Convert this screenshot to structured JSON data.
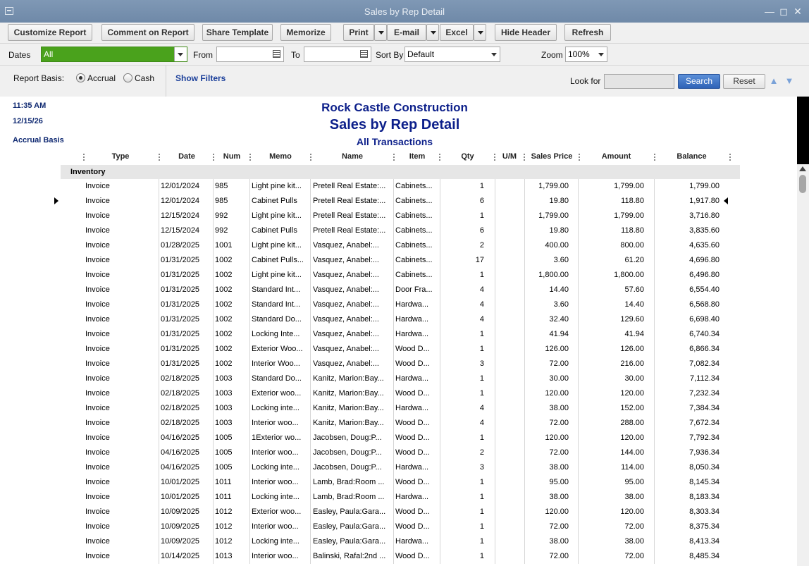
{
  "window": {
    "title": "Sales by Rep Detail"
  },
  "toolbar": {
    "customize": "Customize Report",
    "comment": "Comment on Report",
    "share": "Share Template",
    "memorize": "Memorize",
    "print": "Print",
    "email": "E-mail",
    "excel": "Excel",
    "hide_header": "Hide Header",
    "refresh": "Refresh"
  },
  "filters": {
    "dates_label": "Dates",
    "dates_value": "All",
    "from_label": "From",
    "from_value": "",
    "to_label": "To",
    "to_value": "",
    "sortby_label": "Sort By",
    "sortby_value": "Default",
    "zoom_label": "Zoom",
    "zoom_value": "100%"
  },
  "basis": {
    "label": "Report Basis:",
    "accrual": "Accrual",
    "cash": "Cash",
    "selected": "Accrual",
    "show_filters": "Show Filters",
    "lookfor_label": "Look for",
    "lookfor_value": "",
    "search": "Search",
    "reset": "Reset"
  },
  "report": {
    "time": "11:35 AM",
    "date": "12/15/26",
    "basis": "Accrual Basis",
    "company": "Rock Castle Construction",
    "title": "Sales by Rep Detail",
    "subtitle": "All Transactions",
    "columns": [
      "Type",
      "Date",
      "Num",
      "Memo",
      "Name",
      "Item",
      "Qty",
      "U/M",
      "Sales Price",
      "Amount",
      "Balance"
    ],
    "section": "Inventory",
    "rows": [
      [
        "Invoice",
        "12/01/2024",
        "985",
        "Light pine kit...",
        "Pretell Real Estate:...",
        "Cabinets...",
        "1",
        "",
        "1,799.00",
        "1,799.00",
        "1,799.00"
      ],
      [
        "Invoice",
        "12/01/2024",
        "985",
        "Cabinet Pulls",
        "Pretell Real Estate:...",
        "Cabinets...",
        "6",
        "",
        "19.80",
        "118.80",
        "1,917.80"
      ],
      [
        "Invoice",
        "12/15/2024",
        "992",
        "Light pine kit...",
        "Pretell Real Estate:...",
        "Cabinets...",
        "1",
        "",
        "1,799.00",
        "1,799.00",
        "3,716.80"
      ],
      [
        "Invoice",
        "12/15/2024",
        "992",
        "Cabinet Pulls",
        "Pretell Real Estate:...",
        "Cabinets...",
        "6",
        "",
        "19.80",
        "118.80",
        "3,835.60"
      ],
      [
        "Invoice",
        "01/28/2025",
        "1001",
        "Light pine kit...",
        "Vasquez, Anabel:...",
        "Cabinets...",
        "2",
        "",
        "400.00",
        "800.00",
        "4,635.60"
      ],
      [
        "Invoice",
        "01/31/2025",
        "1002",
        "Cabinet Pulls...",
        "Vasquez, Anabel:...",
        "Cabinets...",
        "17",
        "",
        "3.60",
        "61.20",
        "4,696.80"
      ],
      [
        "Invoice",
        "01/31/2025",
        "1002",
        "Light pine kit...",
        "Vasquez, Anabel:...",
        "Cabinets...",
        "1",
        "",
        "1,800.00",
        "1,800.00",
        "6,496.80"
      ],
      [
        "Invoice",
        "01/31/2025",
        "1002",
        "Standard Int...",
        "Vasquez, Anabel:...",
        "Door Fra...",
        "4",
        "",
        "14.40",
        "57.60",
        "6,554.40"
      ],
      [
        "Invoice",
        "01/31/2025",
        "1002",
        "Standard Int...",
        "Vasquez, Anabel:...",
        "Hardwa...",
        "4",
        "",
        "3.60",
        "14.40",
        "6,568.80"
      ],
      [
        "Invoice",
        "01/31/2025",
        "1002",
        "Standard Do...",
        "Vasquez, Anabel:...",
        "Hardwa...",
        "4",
        "",
        "32.40",
        "129.60",
        "6,698.40"
      ],
      [
        "Invoice",
        "01/31/2025",
        "1002",
        "Locking Inte...",
        "Vasquez, Anabel:...",
        "Hardwa...",
        "1",
        "",
        "41.94",
        "41.94",
        "6,740.34"
      ],
      [
        "Invoice",
        "01/31/2025",
        "1002",
        "Exterior Woo...",
        "Vasquez, Anabel:...",
        "Wood D...",
        "1",
        "",
        "126.00",
        "126.00",
        "6,866.34"
      ],
      [
        "Invoice",
        "01/31/2025",
        "1002",
        "Interior Woo...",
        "Vasquez, Anabel:...",
        "Wood D...",
        "3",
        "",
        "72.00",
        "216.00",
        "7,082.34"
      ],
      [
        "Invoice",
        "02/18/2025",
        "1003",
        "Standard Do...",
        "Kanitz, Marion:Bay...",
        "Hardwa...",
        "1",
        "",
        "30.00",
        "30.00",
        "7,112.34"
      ],
      [
        "Invoice",
        "02/18/2025",
        "1003",
        "Exterior woo...",
        "Kanitz, Marion:Bay...",
        "Wood D...",
        "1",
        "",
        "120.00",
        "120.00",
        "7,232.34"
      ],
      [
        "Invoice",
        "02/18/2025",
        "1003",
        "Locking inte...",
        "Kanitz, Marion:Bay...",
        "Hardwa...",
        "4",
        "",
        "38.00",
        "152.00",
        "7,384.34"
      ],
      [
        "Invoice",
        "02/18/2025",
        "1003",
        "Interior woo...",
        "Kanitz, Marion:Bay...",
        "Wood D...",
        "4",
        "",
        "72.00",
        "288.00",
        "7,672.34"
      ],
      [
        "Invoice",
        "04/16/2025",
        "1005",
        "1Exterior wo...",
        "Jacobsen, Doug:P...",
        "Wood D...",
        "1",
        "",
        "120.00",
        "120.00",
        "7,792.34"
      ],
      [
        "Invoice",
        "04/16/2025",
        "1005",
        "Interior woo...",
        "Jacobsen, Doug:P...",
        "Wood D...",
        "2",
        "",
        "72.00",
        "144.00",
        "7,936.34"
      ],
      [
        "Invoice",
        "04/16/2025",
        "1005",
        "Locking inte...",
        "Jacobsen, Doug:P...",
        "Hardwa...",
        "3",
        "",
        "38.00",
        "114.00",
        "8,050.34"
      ],
      [
        "Invoice",
        "10/01/2025",
        "1011",
        "Interior woo...",
        "Lamb, Brad:Room ...",
        "Wood D...",
        "1",
        "",
        "95.00",
        "95.00",
        "8,145.34"
      ],
      [
        "Invoice",
        "10/01/2025",
        "1011",
        "Locking inte...",
        "Lamb, Brad:Room ...",
        "Hardwa...",
        "1",
        "",
        "38.00",
        "38.00",
        "8,183.34"
      ],
      [
        "Invoice",
        "10/09/2025",
        "1012",
        "Exterior woo...",
        "Easley, Paula:Gara...",
        "Wood D...",
        "1",
        "",
        "120.00",
        "120.00",
        "8,303.34"
      ],
      [
        "Invoice",
        "10/09/2025",
        "1012",
        "Interior woo...",
        "Easley, Paula:Gara...",
        "Wood D...",
        "1",
        "",
        "72.00",
        "72.00",
        "8,375.34"
      ],
      [
        "Invoice",
        "10/09/2025",
        "1012",
        "Locking inte...",
        "Easley, Paula:Gara...",
        "Hardwa...",
        "1",
        "",
        "38.00",
        "38.00",
        "8,413.34"
      ],
      [
        "Invoice",
        "10/14/2025",
        "1013",
        "Interior woo...",
        "Balinski, Rafal:2nd ...",
        "Wood D...",
        "1",
        "",
        "72.00",
        "72.00",
        "8,485.34"
      ]
    ]
  }
}
